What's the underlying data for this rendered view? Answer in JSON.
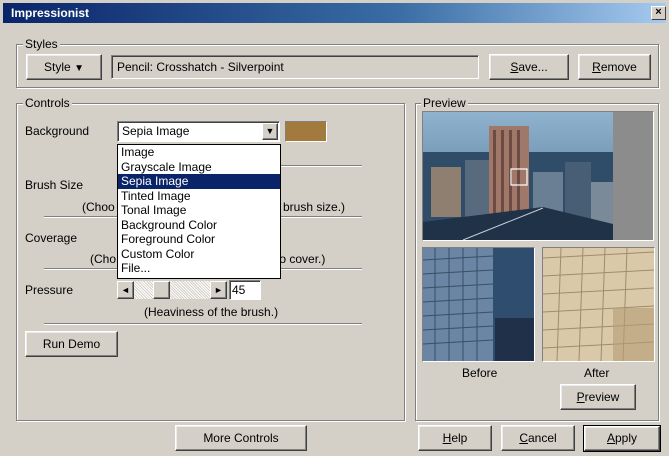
{
  "window": {
    "title": "Impressionist",
    "close_glyph": "×"
  },
  "styles": {
    "legend": "Styles",
    "style_button": "Style",
    "current_style": "Pencil: Crosshatch - Silverpoint",
    "save_prefix": "S",
    "save_rest": "ave...",
    "remove_prefix": "R",
    "remove_rest": "emove"
  },
  "controls": {
    "legend": "Controls",
    "background_label": "Background",
    "background_value": "Sepia Image",
    "background_swatch_color": "#a37a3e",
    "dropdown_options": [
      "Image",
      "Grayscale Image",
      "Sepia Image",
      "Tinted Image",
      "Tonal Image",
      "Background Color",
      "Foreground Color",
      "Custom Color",
      "File..."
    ],
    "dropdown_selected_index": 2,
    "brush_size_label": "Brush Size",
    "brush_size_hint_left": "(Choo",
    "brush_size_hint_right": "brush size.)",
    "coverage_label": "Coverage",
    "coverage_hint_left": "(Cho",
    "coverage_hint_right": "to cover.)",
    "pressure_label": "Pressure",
    "pressure_value": "45",
    "pressure_hint": "(Heaviness of the brush.)",
    "run_demo": "Run Demo"
  },
  "preview": {
    "legend": "Preview",
    "before_label": "Before",
    "after_label": "After",
    "preview_prefix": "P",
    "preview_rest": "review"
  },
  "footer": {
    "more_controls": "More Controls",
    "help_prefix": "H",
    "help_rest": "elp",
    "cancel_prefix": "C",
    "cancel_rest": "ancel",
    "apply_prefix": "A",
    "apply_rest": "pply"
  },
  "icons": {
    "dropdown_arrow": "▼",
    "scroll_left": "◄",
    "scroll_right": "►"
  }
}
